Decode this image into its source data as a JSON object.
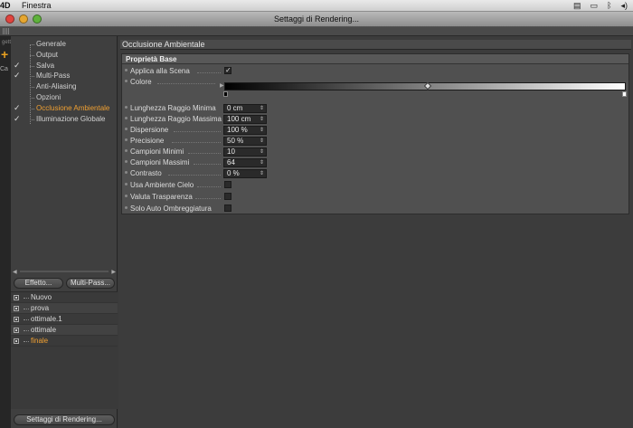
{
  "menubar": {
    "app_fragment": "4D",
    "menu": "Finestra"
  },
  "window": {
    "title": "Settaggi di Rendering..."
  },
  "bg_app": {
    "tag": "Ca",
    "tag2": "getti"
  },
  "sidebar": {
    "items": [
      {
        "label": "Generale",
        "checked": ""
      },
      {
        "label": "Output",
        "checked": ""
      },
      {
        "label": "Salva",
        "checked": "✓"
      },
      {
        "label": "Multi-Pass",
        "checked": "✓"
      },
      {
        "label": "Anti-Aliasing",
        "checked": ""
      },
      {
        "label": "Opzioni",
        "checked": ""
      },
      {
        "label": "Occlusione Ambientale",
        "checked": "✓"
      },
      {
        "label": "Illuminazione Globale",
        "checked": "✓"
      }
    ],
    "effetto_button": "Effetto...",
    "multipass_button": "Multi-Pass...",
    "presets": [
      "Nuovo",
      "prova",
      "ottimale.1",
      "ottimale",
      "finale"
    ],
    "settings_button": "Settaggi di Rendering..."
  },
  "main": {
    "section_title": "Occlusione Ambientale",
    "group_title": "Proprietà Base",
    "props": {
      "applica": {
        "label": "Applica alla Scena",
        "value": "✓"
      },
      "colore": {
        "label": "Colore"
      },
      "raggio_min": {
        "label": "Lunghezza Raggio Minima",
        "value": "0 cm"
      },
      "raggio_max": {
        "label": "Lunghezza Raggio Massima",
        "value": "100 cm"
      },
      "dispersione": {
        "label": "Dispersione",
        "value": "100 %"
      },
      "precisione": {
        "label": "Precisione",
        "value": "50 %"
      },
      "campioni_min": {
        "label": "Campioni Minimi",
        "value": "10"
      },
      "campioni_max": {
        "label": "Campioni Massimi",
        "value": "64"
      },
      "contrasto": {
        "label": "Contrasto",
        "value": "0 %"
      },
      "ambiente_cielo": {
        "label": "Usa Ambiente Cielo",
        "value": ""
      },
      "trasparenza": {
        "label": "Valuta Trasparenza",
        "value": ""
      },
      "solo_auto": {
        "label": "Solo Auto Ombreggiatura",
        "value": ""
      }
    }
  }
}
